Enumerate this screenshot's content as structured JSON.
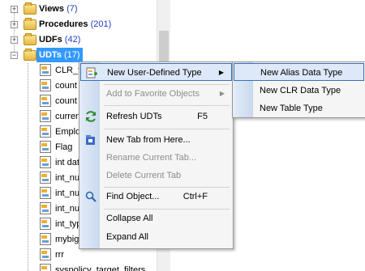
{
  "tree": {
    "nodes": [
      {
        "label": "Views",
        "count": "(7)"
      },
      {
        "label": "Procedures",
        "count": "(201)"
      },
      {
        "label": "UDFs",
        "count": "(42)"
      },
      {
        "label": "UDTs",
        "count": "(17)"
      }
    ],
    "children": [
      "CLR_t",
      "count",
      "count",
      "curren",
      "Emplo",
      "Flag",
      "int dat",
      "int_nu",
      "int_nu",
      "int_nu",
      "int_typ",
      "mybig",
      "rrr",
      "syspolicy_target_filters"
    ]
  },
  "menu": {
    "items": [
      {
        "label": "New User-Defined Type",
        "key": ""
      },
      {
        "label": "Add to Favorite Objects",
        "key": ""
      },
      {
        "label": "Refresh UDTs",
        "key": "F5"
      },
      {
        "label": "New Tab from Here...",
        "key": ""
      },
      {
        "label": "Rename Current Tab...",
        "key": ""
      },
      {
        "label": "Delete Current Tab",
        "key": ""
      },
      {
        "label": "Find Object...",
        "key": "Ctrl+F"
      },
      {
        "label": "Collapse All",
        "key": ""
      },
      {
        "label": "Expand All",
        "key": ""
      }
    ]
  },
  "submenu": {
    "items": [
      {
        "label": "New Alias Data Type"
      },
      {
        "label": "New CLR Data Type"
      },
      {
        "label": "New Table Type"
      }
    ]
  },
  "icons": {
    "expand": "plus-expander-icon",
    "collapse": "minus-expander-icon",
    "folder": "folder-icon",
    "udt": "user-defined-type-icon",
    "refresh": "refresh-icon",
    "new_tab": "new-tab-icon",
    "find": "magnifier-icon"
  }
}
